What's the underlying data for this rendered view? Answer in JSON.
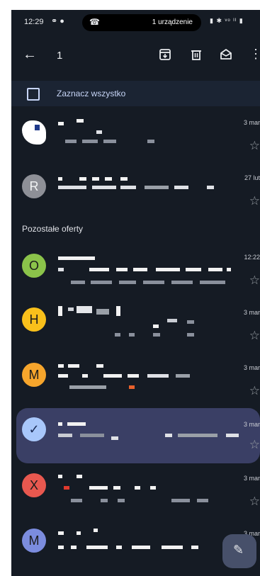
{
  "status": {
    "time": "12:29",
    "icons": "⚭ ●",
    "pill_text": "1 urządzenie",
    "right_icons": "▮ ✱ ᵛᵒ ᴵᴵ ▮"
  },
  "appbar": {
    "back_glyph": "←",
    "selected_count": "1",
    "more_glyph": "⋮"
  },
  "select_all": {
    "label": "Zaznacz wszystko"
  },
  "section_header": "Pozostałe oferty",
  "emails": [
    {
      "avatar_letter": "",
      "avatar_color": "#ffffff",
      "date": "3 mar",
      "selected": false
    },
    {
      "avatar_letter": "R",
      "avatar_color": "#8e9097",
      "date": "27 lut",
      "selected": false
    },
    {
      "avatar_letter": "O",
      "avatar_color": "#8bc34a",
      "date": "12:22",
      "selected": false
    },
    {
      "avatar_letter": "H",
      "avatar_color": "#f9c01b",
      "date": "3 mar",
      "selected": false
    },
    {
      "avatar_letter": "M",
      "avatar_color": "#f6a52c",
      "date": "3 mar",
      "selected": false
    },
    {
      "avatar_letter": "✓",
      "avatar_color": "#a8c7fa",
      "date": "3 mar",
      "selected": true
    },
    {
      "avatar_letter": "X",
      "avatar_color": "#e8584f",
      "date": "3 mar",
      "selected": false
    },
    {
      "avatar_letter": "M",
      "avatar_color": "#7b8cde",
      "date": "3 mar",
      "selected": false
    }
  ],
  "star_glyph": "☆",
  "fab": {
    "glyph": "✎"
  },
  "colors": {
    "background": "#151b24",
    "accent": "#a8c7fa",
    "selected_row": "#3a3f65"
  }
}
